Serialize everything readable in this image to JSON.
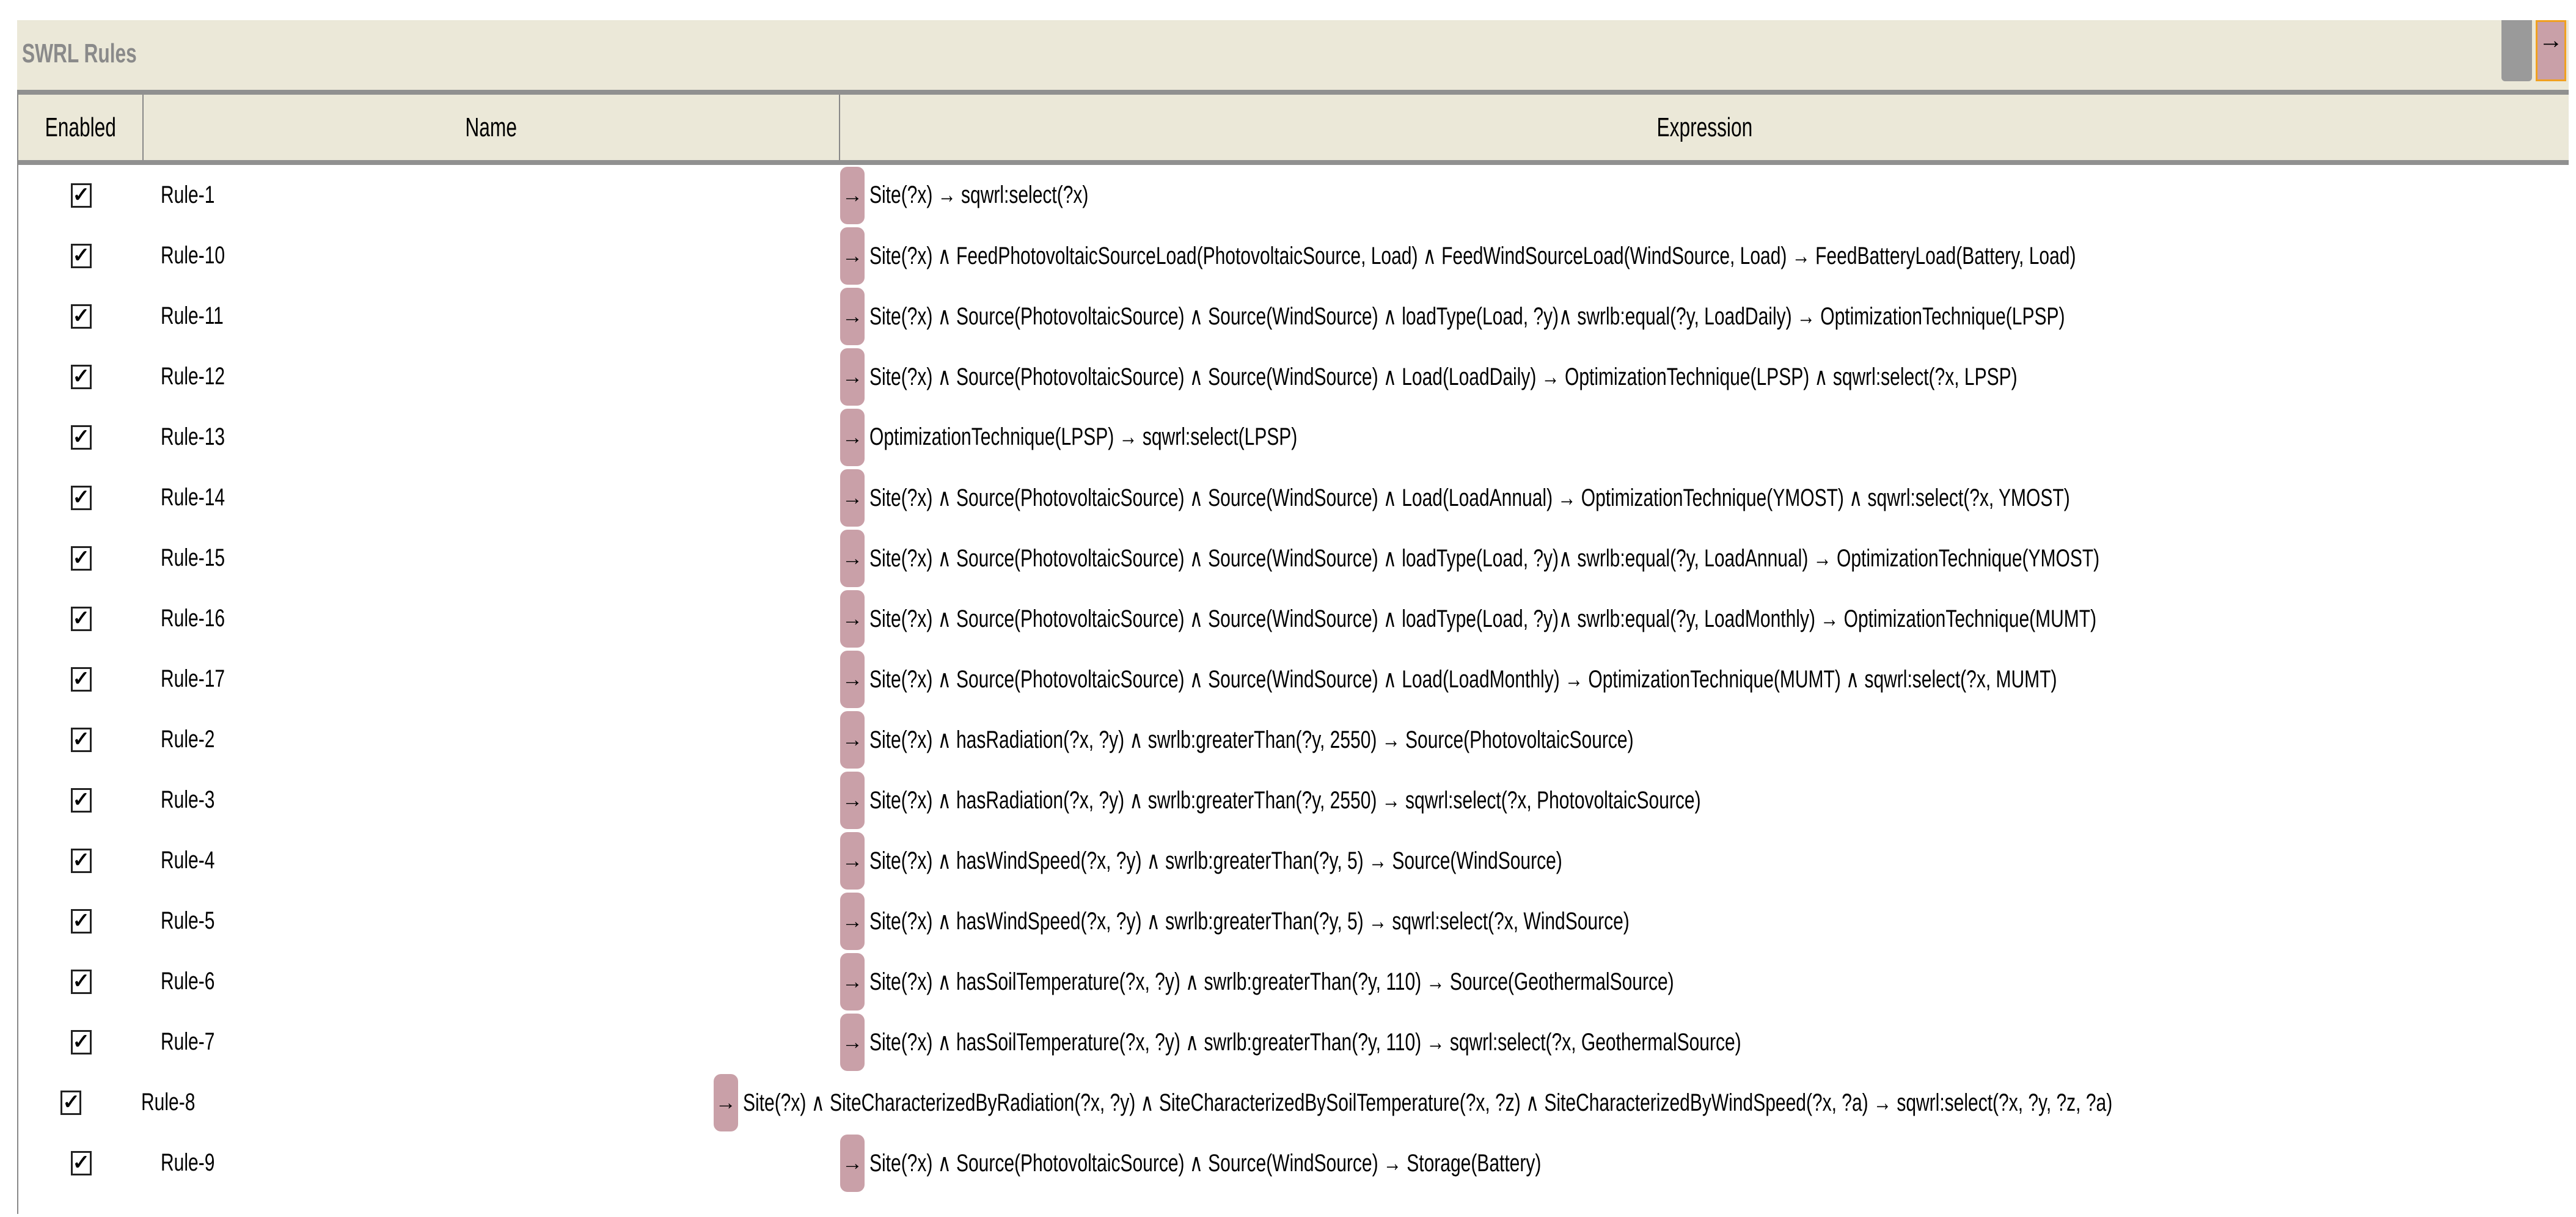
{
  "panel": {
    "title": "SWRL Rules"
  },
  "columns": {
    "enabled": "Enabled",
    "name": "Name",
    "expression": "Expression"
  },
  "rules": [
    {
      "name": "Rule-1",
      "expr": "Site(?x) → sqwrl:select(?x)"
    },
    {
      "name": "Rule-10",
      "expr": "Site(?x) ∧ FeedPhotovoltaicSourceLoad(PhotovoltaicSource, Load) ∧ FeedWindSourceLoad(WindSource, Load) → FeedBatteryLoad(Battery, Load)"
    },
    {
      "name": "Rule-11",
      "expr": "Site(?x) ∧ Source(PhotovoltaicSource) ∧ Source(WindSource) ∧ loadType(Load, ?y)∧  swrlb:equal(?y, LoadDaily) → OptimizationTechnique(LPSP)"
    },
    {
      "name": "Rule-12",
      "expr": "Site(?x) ∧ Source(PhotovoltaicSource) ∧ Source(WindSource) ∧ Load(LoadDaily) → OptimizationTechnique(LPSP) ∧ sqwrl:select(?x, LPSP)"
    },
    {
      "name": "Rule-13",
      "expr": "OptimizationTechnique(LPSP) → sqwrl:select(LPSP)"
    },
    {
      "name": "Rule-14",
      "expr": "Site(?x) ∧ Source(PhotovoltaicSource) ∧ Source(WindSource) ∧ Load(LoadAnnual) → OptimizationTechnique(YMOST) ∧ sqwrl:select(?x, YMOST)"
    },
    {
      "name": "Rule-15",
      "expr": "Site(?x) ∧ Source(PhotovoltaicSource) ∧ Source(WindSource) ∧ loadType(Load, ?y)∧  swrlb:equal(?y, LoadAnnual) → OptimizationTechnique(YMOST)"
    },
    {
      "name": "Rule-16",
      "expr": "Site(?x) ∧ Source(PhotovoltaicSource) ∧ Source(WindSource) ∧ loadType(Load, ?y)∧  swrlb:equal(?y, LoadMonthly) → OptimizationTechnique(MUMT)"
    },
    {
      "name": "Rule-17",
      "expr": "Site(?x) ∧ Source(PhotovoltaicSource) ∧ Source(WindSource) ∧ Load(LoadMonthly) → OptimizationTechnique(MUMT) ∧ sqwrl:select(?x, MUMT)"
    },
    {
      "name": "Rule-2",
      "expr": "Site(?x) ∧ hasRadiation(?x, ?y) ∧ swrlb:greaterThan(?y, 2550) → Source(PhotovoltaicSource)"
    },
    {
      "name": "Rule-3",
      "expr": "Site(?x) ∧ hasRadiation(?x, ?y) ∧ swrlb:greaterThan(?y, 2550) → sqwrl:select(?x, PhotovoltaicSource)"
    },
    {
      "name": "Rule-4",
      "expr": "Site(?x) ∧ hasWindSpeed(?x, ?y) ∧ swrlb:greaterThan(?y, 5) → Source(WindSource)"
    },
    {
      "name": "Rule-5",
      "expr": "Site(?x) ∧ hasWindSpeed(?x, ?y) ∧ swrlb:greaterThan(?y, 5) → sqwrl:select(?x, WindSource)"
    },
    {
      "name": "Rule-6",
      "expr": "Site(?x) ∧ hasSoilTemperature(?x, ?y) ∧ swrlb:greaterThan(?y, 110) → Source(GeothermalSource)"
    },
    {
      "name": "Rule-7",
      "expr": "Site(?x) ∧ hasSoilTemperature(?x, ?y) ∧ swrlb:greaterThan(?y, 110) → sqwrl:select(?x, GeothermalSource)"
    },
    {
      "name": "Rule-8",
      "expr": "Site(?x) ∧ SiteCharacterizedByRadiation(?x, ?y) ∧ SiteCharacterizedBySoilTemperature(?x, ?z) ∧ SiteCharacterizedByWindSpeed(?x, ?a) → sqwrl:select(?x, ?y, ?z, ?a)"
    },
    {
      "name": "Rule-9",
      "expr": "Site(?x) ∧ Source(PhotovoltaicSource) ∧ Source(WindSource) → Storage(Battery)"
    }
  ]
}
